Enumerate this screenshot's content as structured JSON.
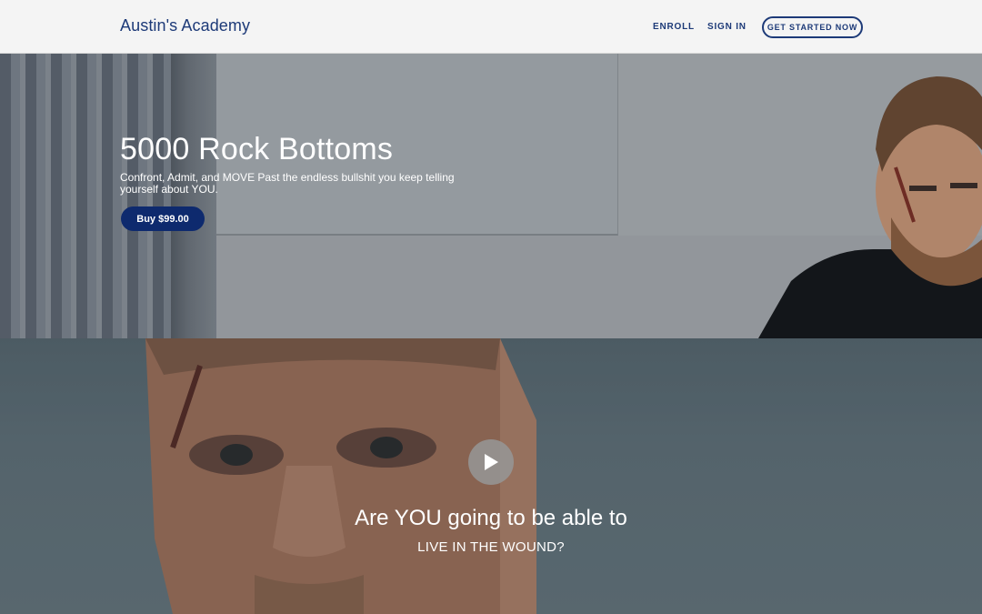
{
  "header": {
    "brand": "Austin's Academy",
    "nav": {
      "enroll": "ENROLL",
      "sign_in": "SIGN IN",
      "cta": "GET STARTED NOW"
    }
  },
  "hero": {
    "title": "5000 Rock Bottoms",
    "subtitle": "Confront, Admit, and MOVE Past the endless bullshit you keep telling yourself about YOU.",
    "buy_label": "Buy $99.00"
  },
  "video": {
    "heading": "Are YOU going to be able to",
    "subheading": "LIVE IN THE WOUND?",
    "play_icon": "play-icon"
  },
  "colors": {
    "brand": "#1d3a78",
    "button": "#0e2a6e",
    "header_bg": "#f4f4f4"
  }
}
